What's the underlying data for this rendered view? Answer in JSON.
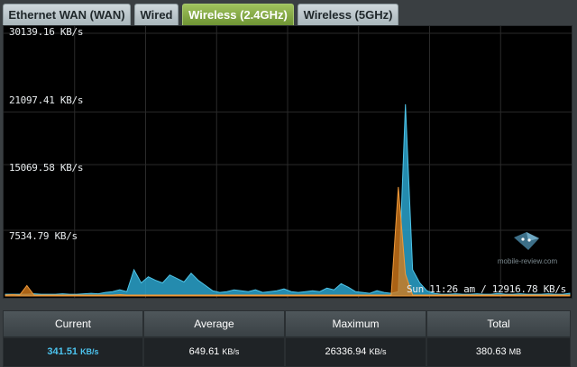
{
  "tabs": [
    {
      "label": "Ethernet WAN (WAN)",
      "active": false
    },
    {
      "label": "Wired",
      "active": false
    },
    {
      "label": "Wireless (2.4GHz)",
      "active": true
    },
    {
      "label": "Wireless (5GHz)",
      "active": false
    }
  ],
  "graph": {
    "y_labels": [
      "30139.16 KB/s",
      "21097.41 KB/s",
      "15069.58 KB/s",
      "7534.79 KB/s"
    ],
    "hover_info": "Sun 11:26 am / 12916.78 KB/s",
    "colors": {
      "rx": "#2aa3cc",
      "tx": "#d47a1a",
      "overlap": "#6fb59d",
      "grid": "#2a2a2a"
    }
  },
  "chart_data": {
    "type": "area",
    "ylim": [
      0,
      30139.16
    ],
    "y_ticks": [
      30139.16,
      21097.41,
      15069.58,
      7534.79
    ],
    "series": [
      {
        "values": [
          200,
          200,
          200,
          200,
          250,
          200,
          200,
          200,
          250,
          200,
          200,
          250,
          300,
          250,
          400,
          500,
          700,
          500,
          3000,
          1500,
          2200,
          1800,
          1500,
          2400,
          2000,
          1600,
          2600,
          1800,
          1200,
          600,
          400,
          500,
          700,
          600,
          500,
          700,
          400,
          500,
          600,
          800,
          500,
          400,
          500,
          600,
          500,
          900,
          700,
          1400,
          1000,
          500,
          400,
          300,
          600,
          400,
          300,
          500,
          22000,
          3000,
          1500,
          600,
          300,
          200,
          200,
          250,
          200,
          200,
          250,
          200,
          200,
          300,
          200,
          200,
          250,
          200,
          200,
          200,
          250,
          200,
          200,
          300
        ]
      },
      {
        "values": [
          100,
          150,
          100,
          1200,
          100,
          100,
          100,
          100,
          100,
          100,
          100,
          100,
          100,
          100,
          100,
          100,
          150,
          100,
          100,
          100,
          100,
          100,
          100,
          100,
          100,
          100,
          100,
          100,
          100,
          100,
          100,
          100,
          100,
          100,
          100,
          100,
          100,
          100,
          100,
          100,
          100,
          100,
          100,
          100,
          100,
          100,
          100,
          100,
          100,
          100,
          100,
          100,
          100,
          100,
          100,
          12500,
          2500,
          100,
          100,
          100,
          100,
          100,
          100,
          100,
          100,
          100,
          100,
          100,
          100,
          100,
          100,
          100,
          100,
          100,
          100,
          100,
          100,
          100,
          100,
          100
        ]
      }
    ]
  },
  "watermark": {
    "text": "mobile-review.com"
  },
  "stats": {
    "headers": [
      "Current",
      "Average",
      "Maximum",
      "Total"
    ],
    "current": {
      "value": "341.51",
      "unit": "KB/s"
    },
    "average": {
      "value": "649.61",
      "unit": "KB/s"
    },
    "maximum": {
      "value": "26336.94",
      "unit": "KB/s"
    },
    "total": {
      "value": "380.63",
      "unit": "MB"
    }
  }
}
